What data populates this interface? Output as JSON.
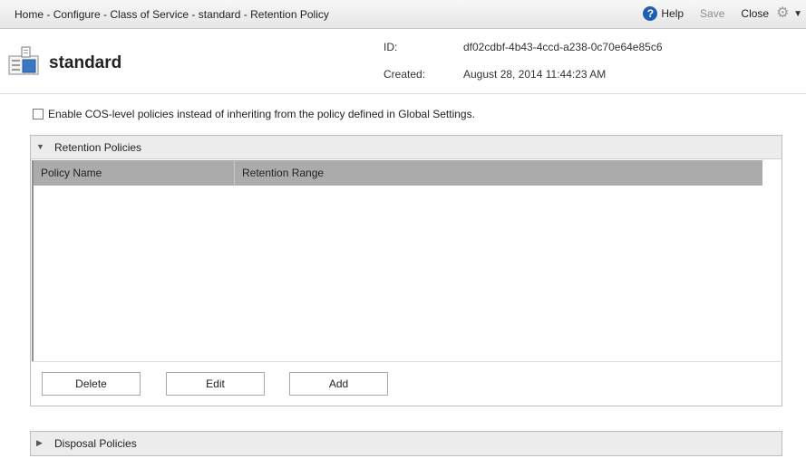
{
  "breadcrumb": {
    "items": [
      "Home",
      "Configure",
      "Class of Service",
      "standard",
      "Retention Policy"
    ],
    "separator": " - "
  },
  "toolbar": {
    "help_label": "Help",
    "save_label": "Save",
    "close_label": "Close"
  },
  "header": {
    "title": "standard",
    "id_label": "ID:",
    "id_value": "df02cdbf-4b43-4ccd-a238-0c70e64e85c6",
    "created_label": "Created:",
    "created_value": "August 28, 2014 11:44:23 AM"
  },
  "cos_checkbox": {
    "label": "Enable COS-level policies instead of inheriting from the policy defined in Global Settings.",
    "checked": false
  },
  "retention_panel": {
    "title": "Retention Policies",
    "expanded": true,
    "columns": [
      "Policy Name",
      "Retention Range"
    ],
    "rows": [],
    "buttons": {
      "delete": "Delete",
      "edit": "Edit",
      "add": "Add"
    }
  },
  "disposal_panel": {
    "title": "Disposal Policies",
    "expanded": false
  },
  "colors": {
    "help_icon": "#1e5fb4",
    "table_header": "#ababab",
    "panel_header": "#ececec"
  }
}
